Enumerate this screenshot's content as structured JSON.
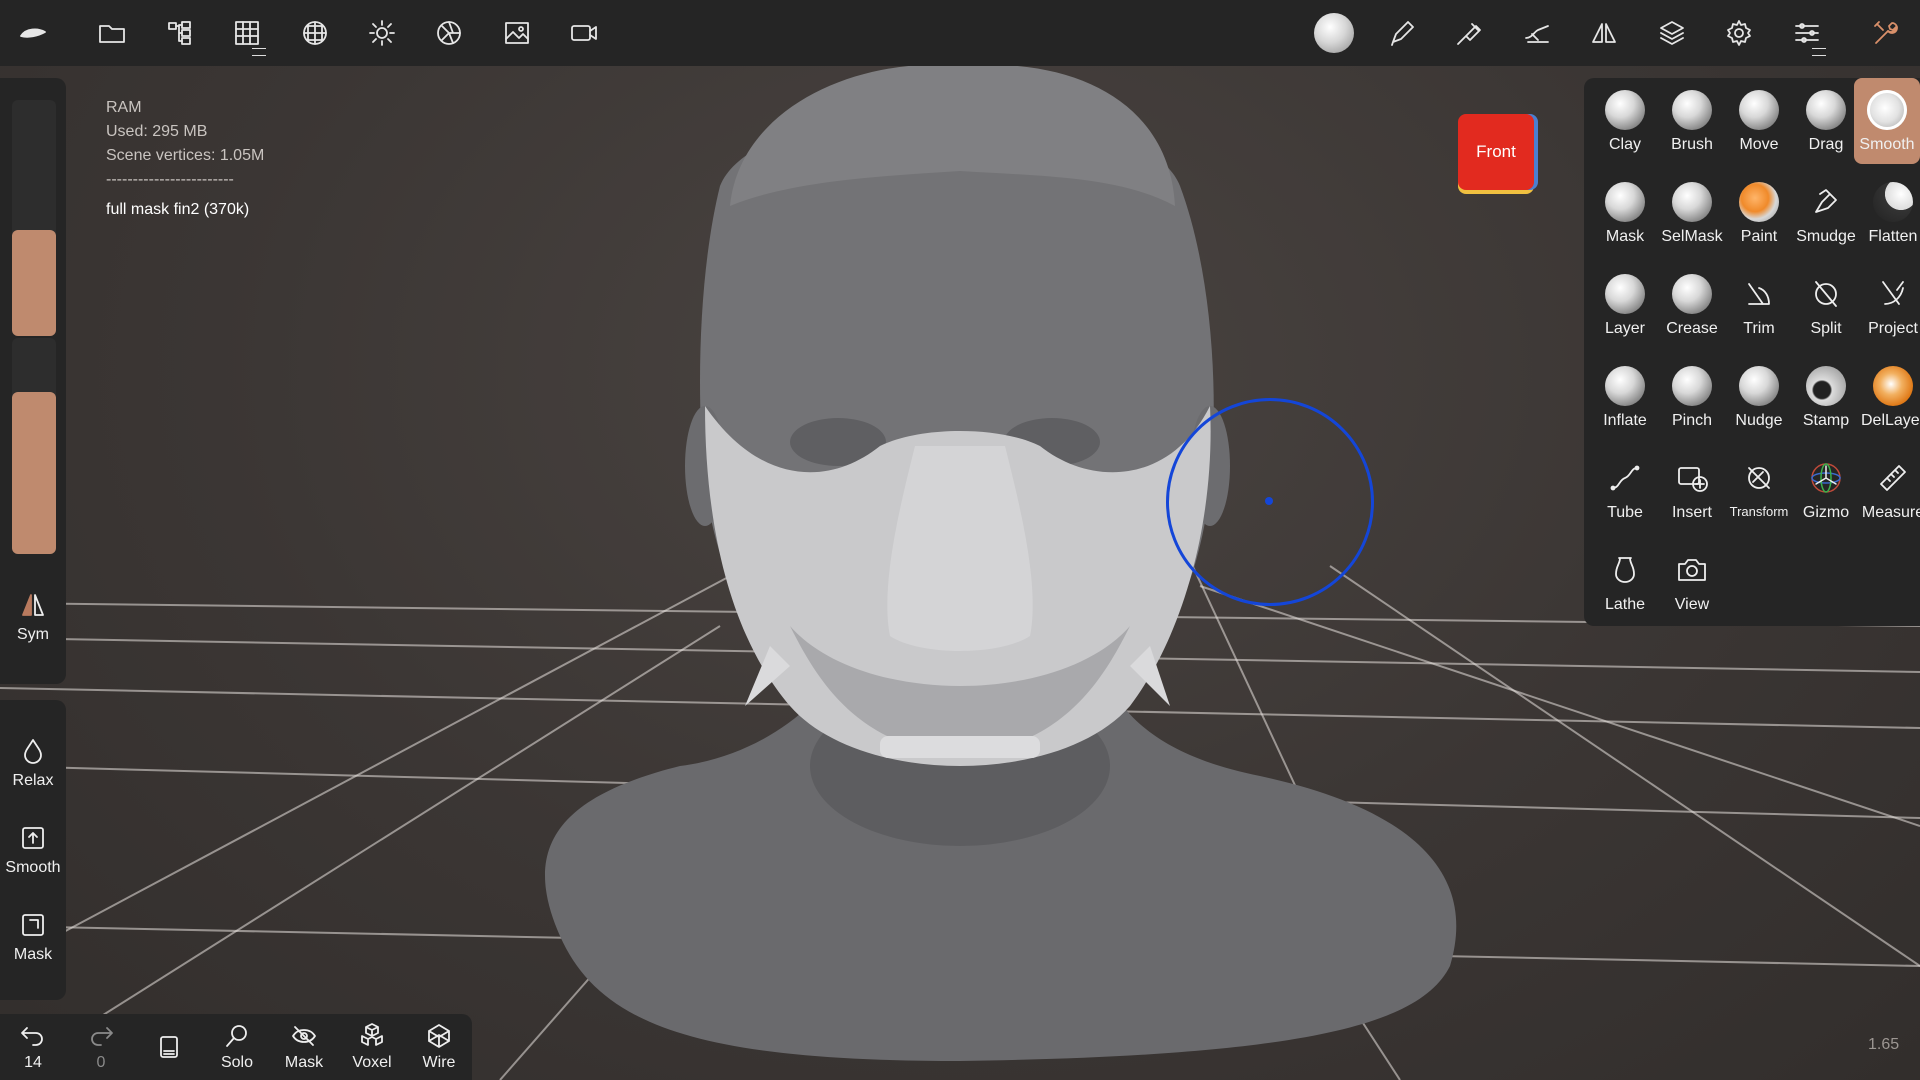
{
  "app": {
    "name": "Nomad Sculpt"
  },
  "topbar": {
    "left_icons": [
      "logo-icon",
      "folder-icon",
      "scene-tree-icon",
      "grid-icon",
      "topology-icon",
      "light-icon",
      "material-icon",
      "background-image-icon",
      "video-icon"
    ],
    "right_icons": [
      "material-ball-icon",
      "pen-icon",
      "brush-settings-icon",
      "stroke-icon",
      "symmetry-icon",
      "layers-icon",
      "settings-icon",
      "sliders-icon",
      "tools-icon"
    ]
  },
  "info": {
    "ram_label": "RAM",
    "used": "Used: 295 MB",
    "vertices": "Scene vertices: 1.05M",
    "separator": "------------------------",
    "object_name": "full mask fin2 (370k)"
  },
  "left_panel": {
    "sym_label": "Sym",
    "slider_radius_level": 0.45,
    "slider_intensity_level": 0.75
  },
  "left_panel2": {
    "relax_label": "Relax",
    "smooth_label": "Smooth",
    "mask_label": "Mask"
  },
  "bottom_bar": {
    "undo_count": "14",
    "redo_count": "0",
    "solo_label": "Solo",
    "mask_label": "Mask",
    "voxel_label": "Voxel",
    "wire_label": "Wire"
  },
  "viewcube": {
    "label": "Front"
  },
  "tools": {
    "items": [
      {
        "label": "Clay"
      },
      {
        "label": "Brush"
      },
      {
        "label": "Move"
      },
      {
        "label": "Drag"
      },
      {
        "label": "Smooth"
      },
      {
        "label": "Mask"
      },
      {
        "label": "SelMask"
      },
      {
        "label": "Paint"
      },
      {
        "label": "Smudge"
      },
      {
        "label": "Flatten"
      },
      {
        "label": "Layer"
      },
      {
        "label": "Crease"
      },
      {
        "label": "Trim"
      },
      {
        "label": "Split"
      },
      {
        "label": "Project"
      },
      {
        "label": "Inflate"
      },
      {
        "label": "Pinch"
      },
      {
        "label": "Nudge"
      },
      {
        "label": "Stamp"
      },
      {
        "label": "DelLayer"
      },
      {
        "label": "Tube"
      },
      {
        "label": "Insert"
      },
      {
        "label": "Transform"
      },
      {
        "label": "Gizmo"
      },
      {
        "label": "Measure"
      },
      {
        "label": "Lathe"
      },
      {
        "label": "View"
      }
    ],
    "active": "Smooth"
  },
  "status": {
    "fps": "1.65"
  },
  "colors": {
    "accent": "#c08a6e",
    "panel": "#252525",
    "cursor": "#1446d8",
    "viewcube_front": "#e22a1f"
  }
}
